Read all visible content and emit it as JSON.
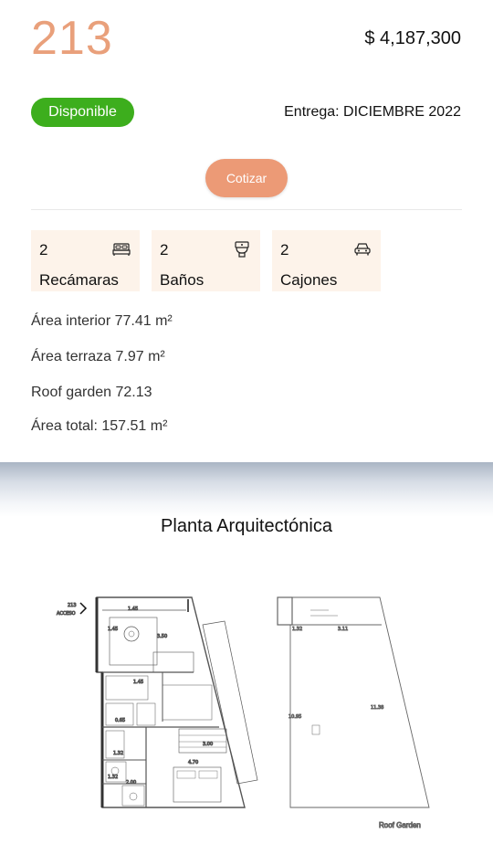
{
  "unit": {
    "number": "213",
    "price": "$ 4,187,300"
  },
  "status": {
    "label": "Disponible",
    "color": "#3dae1d"
  },
  "delivery": "Entrega: DICIEMBRE 2022",
  "cta_label": "Cotizar",
  "features": [
    {
      "count": "2",
      "label": "Recámaras",
      "icon": "bed-icon"
    },
    {
      "count": "2",
      "label": "Baños",
      "icon": "toilet-icon"
    },
    {
      "count": "2",
      "label": "Cajones",
      "icon": "car-icon"
    }
  ],
  "areas": [
    "Área interior 77.41 m²",
    "Área terraza 7.97 m²",
    "Roof garden 72.13",
    "Área total: 157.51 m²"
  ],
  "plans": {
    "title": "Planta Arquitectónica",
    "unit_tag": "213",
    "access_label": "ACCESO",
    "roof_caption": "Roof Garden"
  },
  "colors": {
    "accent": "#ec9a76",
    "unit_number": "#e9a07b",
    "feature_bg": "#fdf3ea"
  }
}
